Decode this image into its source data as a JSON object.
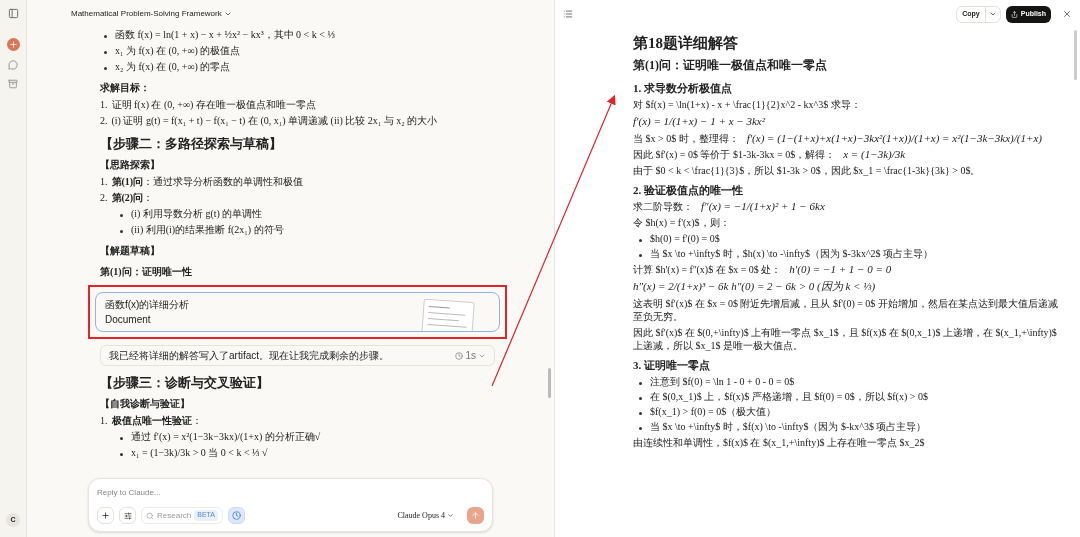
{
  "user": {
    "initial": "C"
  },
  "chat": {
    "title": "Mathematical Problem-Solving Framework",
    "blocks": [
      {
        "kind": "bullets",
        "items": [
          {
            "text": "函数 f(x) = ln(1 + x) − x + ½x² − kx³，其中 0 < k < ⅓"
          },
          {
            "text": "x₁ 为 f(x) 在 (0, +∞) 的极值点"
          },
          {
            "text": "x₂ 为 f(x) 在 (0, +∞) 的零点"
          }
        ]
      },
      {
        "kind": "label",
        "text": "求解目标："
      },
      {
        "kind": "numbered",
        "items": [
          {
            "number": "1.",
            "text": "证明 f(x) 在 (0, +∞) 存在唯一极值点和唯一零点"
          },
          {
            "number": "2.",
            "text": "(i) 证明 g(t) = f(x₁ + t) − f(x₁ − t) 在 (0, x₁) 单调递减 (ii) 比较 2x₁ 与 x₂ 的大小"
          }
        ]
      },
      {
        "kind": "heading",
        "text": "【步骤二：多路径探索与草稿】"
      },
      {
        "kind": "label",
        "text": "【思路探索】"
      },
      {
        "kind": "numbered",
        "items": [
          {
            "number": "1.",
            "text": "**第(1)问**：通过求导分析函数的单调性和极值"
          },
          {
            "number": "2.",
            "text": "**第(2)问**：",
            "children": [
              {
                "text": "(i) 利用导数分析 g(t) 的单调性"
              },
              {
                "text": "(ii) 利用(i)的结果推断 f(2x₁) 的符号"
              }
            ]
          }
        ]
      },
      {
        "kind": "label",
        "text": "【解题草稿】"
      },
      {
        "kind": "label",
        "text": "第(1)问：证明唯一性"
      },
      {
        "kind": "artifact",
        "title": "函数f(x)的详细分析",
        "subtitle": "Document"
      },
      {
        "kind": "note",
        "text": "我已经将详细的解答写入了artifact。现在让我完成剩余的步骤。",
        "time": "1s"
      },
      {
        "kind": "heading",
        "text": "【步骤三：诊断与交叉验证】"
      },
      {
        "kind": "label",
        "text": "【自我诊断与验证】"
      },
      {
        "kind": "numbered",
        "items": [
          {
            "number": "1.",
            "text": "**极值点唯一性验证**：",
            "children": [
              {
                "text": "通过 f′(x) = x²(1−3k−3kx)/(1+x) 的分析正确√"
              },
              {
                "text": "x₁ = (1−3k)/3k > 0 当 0 < k < ⅓ √"
              }
            ]
          }
        ]
      }
    ]
  },
  "composer": {
    "placeholder": "Reply to Claude...",
    "research": "Research",
    "badge": "BETA",
    "model": "Claude Opus 4"
  },
  "artifact_panel": {
    "copy": "Copy",
    "publish": "Publish",
    "blocks": [
      {
        "kind": "h1",
        "text": "第18题详细解答"
      },
      {
        "kind": "h2",
        "text": "第(1)问：证明唯一极值点和唯一零点"
      },
      {
        "kind": "h3",
        "text": "1. 求导数分析极值点"
      },
      {
        "kind": "p",
        "text": "对 $f(x) = \\ln(1+x) - x + \\frac{1}{2}x^2 - kx^3$ 求导："
      },
      {
        "kind": "math",
        "math": "f′(x) = 1/(1+x) − 1 + x − 3kx²"
      },
      {
        "kind": "p",
        "text": "当 $x > 0$ 时，整理得：",
        "math": "f′(x) = (1−(1+x)+x(1+x)−3kx²(1+x))/(1+x) = x²(1−3k−3kx)/(1+x)"
      },
      {
        "kind": "p",
        "text": "因此 $f'(x) = 0$ 等价于 $1-3k-3kx = 0$，解得：",
        "math": "x = (1−3k)/3k"
      },
      {
        "kind": "p",
        "text": "由于 $0 < k < \\frac{1}{3}$，所以 $1-3k > 0$，因此 $x_1 = \\frac{1-3k}{3k} > 0$。"
      },
      {
        "kind": "h3",
        "text": "2. 验证极值点的唯一性"
      },
      {
        "kind": "p",
        "text": "求二阶导数：",
        "math": "f″(x) = −1/(1+x)² + 1 − 6kx"
      },
      {
        "kind": "p",
        "text": "令 $h(x) = f'(x)$，则："
      },
      {
        "kind": "bullets",
        "items": [
          {
            "text": "$h(0) = f'(0) = 0$"
          },
          {
            "text": "当 $x \\to +\\infty$ 时，$h(x) \\to -\\infty$（因为 $-3kx^2$ 项占主导）"
          }
        ]
      },
      {
        "kind": "p",
        "text": "计算 $h'(x) = f''(x)$ 在 $x = 0$ 处：",
        "math": "h′(0) = −1 + 1 − 0 = 0"
      },
      {
        "kind": "math",
        "math": "h″(x) = 2/(1+x)³ − 6k h″(0) = 2 − 6k > 0   (因为 k < ⅓)"
      },
      {
        "kind": "p",
        "text": "这表明 $f'(x)$ 在 $x = 0$ 附近先增后减，且从 $f'(0) = 0$ 开始增加，然后在某点达到最大值后递减至负无穷。"
      },
      {
        "kind": "p",
        "text": "因此 $f'(x)$ 在 $(0,+\\infty)$ 上有唯一零点 $x_1$，且 $f(x)$ 在 $(0,x_1)$ 上递增，在 $(x_1,+\\infty)$ 上递减，所以 $x_1$ 是唯一极大值点。"
      },
      {
        "kind": "h3",
        "text": "3. 证明唯一零点"
      },
      {
        "kind": "bullets",
        "items": [
          {
            "text": "注意到 $f(0) = \\ln 1 - 0 + 0 - 0 = 0$"
          },
          {
            "text": "在 $(0,x_1)$ 上，$f(x)$ 严格递增，且 $f(0) = 0$，所以 $f(x) > 0$"
          },
          {
            "text": "$f(x_1) > f(0) = 0$（极大值）"
          },
          {
            "text": "当 $x \\to +\\infty$ 时，$f(x) \\to -\\infty$（因为 $-kx^3$ 项占主导）"
          }
        ]
      },
      {
        "kind": "p",
        "text": "由连续性和单调性，$f(x)$ 在 $(x_1,+\\infty)$ 上存在唯一零点 $x_2$"
      }
    ]
  }
}
